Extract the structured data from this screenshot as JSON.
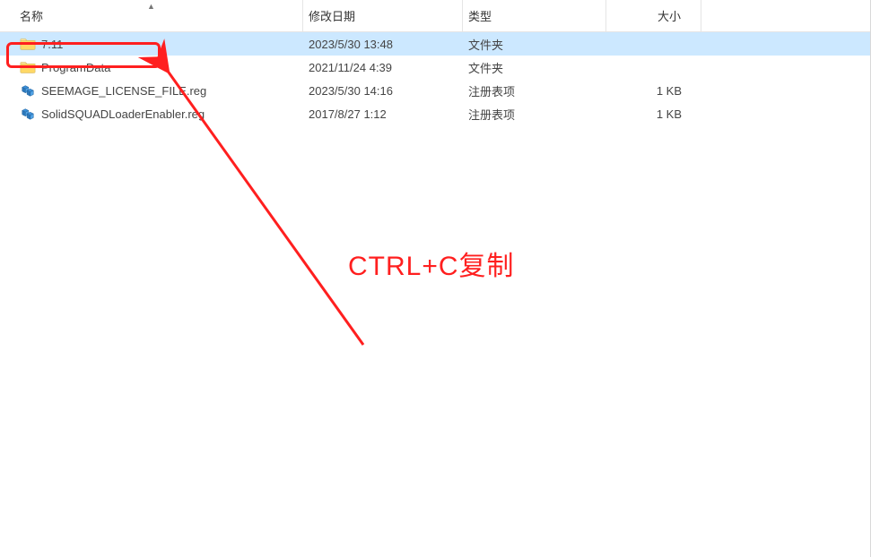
{
  "columns": {
    "name": "名称",
    "date": "修改日期",
    "type": "类型",
    "size": "大小"
  },
  "rows": [
    {
      "name": "7.11",
      "date": "2023/5/30 13:48",
      "type": "文件夹",
      "size": "",
      "icon": "folder",
      "selected": true
    },
    {
      "name": "ProgramData",
      "date": "2021/11/24 4:39",
      "type": "文件夹",
      "size": "",
      "icon": "folder",
      "selected": false
    },
    {
      "name": "SEEMAGE_LICENSE_FILE.reg",
      "date": "2023/5/30 14:16",
      "type": "注册表项",
      "size": "1 KB",
      "icon": "reg",
      "selected": false
    },
    {
      "name": "SolidSQUADLoaderEnabler.reg",
      "date": "2017/8/27 1:12",
      "type": "注册表项",
      "size": "1 KB",
      "icon": "reg",
      "selected": false
    }
  ],
  "annotation": {
    "text": "CTRL+C复制"
  }
}
